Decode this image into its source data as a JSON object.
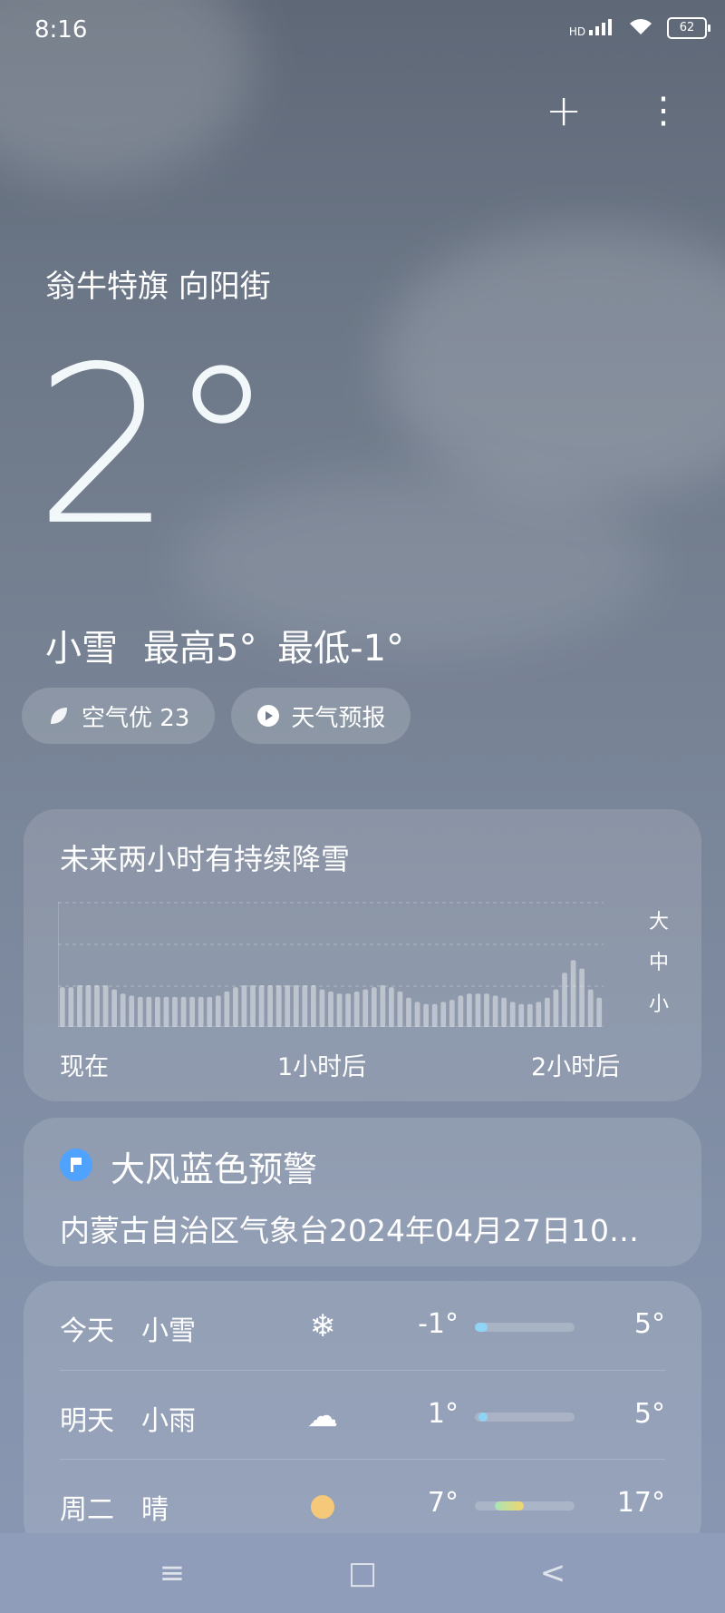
{
  "status": {
    "time": "8:16",
    "signal_tag": "HD",
    "battery": "62"
  },
  "header": {
    "add_label": "+",
    "more_label": "⋮"
  },
  "location": "翁牛特旗 向阳街",
  "current": {
    "temp": "2°",
    "condition": "小雪",
    "high": "最高5°",
    "low": "最低-1°"
  },
  "chips": [
    {
      "label": "空气优 23",
      "icon": "leaf-icon"
    },
    {
      "label": "天气预报",
      "icon": "play-icon"
    }
  ],
  "precip": {
    "title": "未来两小时有持续降雪",
    "scale": [
      "大",
      "中",
      "小"
    ],
    "xlabels": [
      "现在",
      "1小时后",
      "2小时后"
    ],
    "chart_data": {
      "type": "bar",
      "categories": [],
      "values": [
        0.95,
        0.95,
        1.0,
        1.0,
        1.0,
        1.0,
        0.9,
        0.8,
        0.75,
        0.72,
        0.72,
        0.72,
        0.72,
        0.72,
        0.72,
        0.72,
        0.72,
        0.72,
        0.75,
        0.85,
        0.95,
        1.0,
        1.0,
        1.0,
        1.0,
        1.0,
        1.0,
        1.0,
        1.0,
        1.0,
        0.9,
        0.85,
        0.8,
        0.8,
        0.85,
        0.9,
        0.95,
        1.0,
        0.95,
        0.85,
        0.7,
        0.6,
        0.55,
        0.55,
        0.6,
        0.65,
        0.75,
        0.8,
        0.8,
        0.8,
        0.75,
        0.7,
        0.6,
        0.55,
        0.55,
        0.6,
        0.7,
        0.9,
        1.3,
        1.6,
        1.4,
        0.9,
        0.7
      ],
      "ylim": [
        0,
        3
      ]
    }
  },
  "warning": {
    "title": "大风蓝色预警",
    "desc": "内蒙古自治区气象台2024年04月27日10…",
    "color": "#4fa3ff"
  },
  "forecast": [
    {
      "day": "今天",
      "weather": "小雪",
      "icon": "❄",
      "icon_name": "snowflake-icon",
      "low": "-1°",
      "high": "5°"
    },
    {
      "day": "明天",
      "weather": "小雨",
      "icon": "☁",
      "icon_name": "rain-cloud-icon",
      "low": "1°",
      "high": "5°"
    },
    {
      "day": "周二",
      "weather": "晴",
      "icon": "●",
      "icon_name": "sun-icon",
      "low": "7°",
      "high": "17°"
    }
  ],
  "nav": {
    "menu": "≡",
    "home": "□",
    "back": "<"
  }
}
